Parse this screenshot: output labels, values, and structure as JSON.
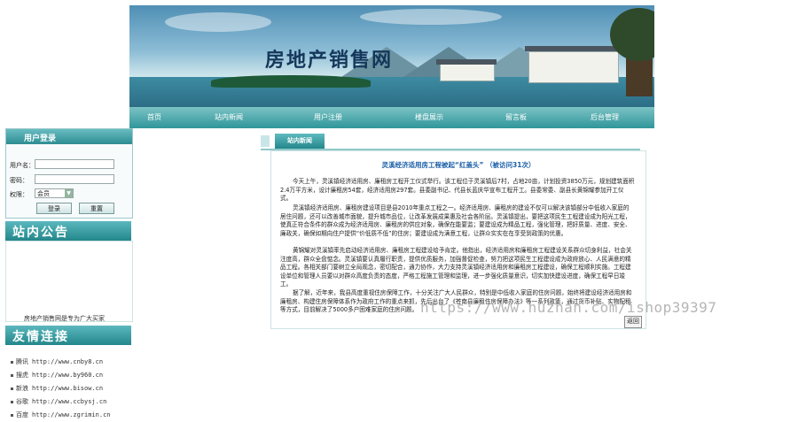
{
  "banner": {
    "title": "房地产销售网"
  },
  "nav": [
    "首页",
    "站内新闻",
    "用户注册",
    "楼盘展示",
    "留言板",
    "后台管理"
  ],
  "login": {
    "heading": "用户登录",
    "username_label": "用户名：",
    "password_label": "密码：",
    "role_label": "权限：",
    "role_value": "会员",
    "login_button": "登录",
    "reset_button": "重置"
  },
  "notice": {
    "heading": "站内公告",
    "text": "房地产销售网是专为广大买家"
  },
  "links": {
    "heading": "友情连接",
    "items": [
      {
        "name": "腾讯",
        "url": "http://www.cnby8.cn"
      },
      {
        "name": "搜虎",
        "url": "http://www.by960.cn"
      },
      {
        "name": "新浪",
        "url": "http://www.bisow.cn"
      },
      {
        "name": "谷歌",
        "url": "http://www.ccbysj.cn"
      },
      {
        "name": "百度",
        "url": "http://www.zgrimin.cn"
      }
    ]
  },
  "news": {
    "tab": "站内新闻",
    "title": "灵溪经济适用房工程被起“红盖头” （被访问31次）",
    "paragraphs": [
      "今天上午，灵溪镇经济适用房、廉租房工程开工仪式举行。该工程位于灵溪镇后7村，占地20亩，计划投资3850万元，规划建筑面积2.4万平方米，设计廉租房54套，经济适用房297套。县委副书记、代县长蓝庆华宣布工程开工。县委常委、副县长黄锦耀参加开工仪式。",
      "灵溪镇经济适用房、廉租房建设项目是县2010年重点工程之一。经济适用房、廉租房的建设不仅可以解决该镇部分中低收入家庭的居住问题，还可以改善城市面貌，提升城市品位，让改革发展成果惠及社会各阶层。灵溪镇提出，要把这项民生工程建设成为阳光工程，使真正符合条件的群众成为经济适用房、廉租房的供应对象，确保在能要监；要建设成为精品工程，强化管理，把好质量、进度、安全、廉政关，确保如期向住户提供“价低质不低”的住房；要建设成为满意工程，让群众实实在在享受到政策的优惠。",
      "黄锦耀对灵溪镇率先启动经济适用房、廉租房工程建设给予肯定。他指出，经济适用房和廉租房工程建设关系群众切身利益，社会关注度高，群众全盘惦念。灵溪镇要认真履行职责，提供优质服务，加强督促检查，努力把这项民生工程建设成为政府放心、人民满意的精品工程。各相关部门要树立全局观念，密切配合，通力协作，大力支持灵溪镇经济适用房和廉租房工程建设，确保工程顺利实施。工程建设单位和管理人员要以对群众高度负责的态度，严格工程施工管理和监理，进一步强化质量意识，切实加快建设进度，确保工程早日竣工。",
      "据了解，近年来，我县高度重视住房保障工作，十分关注广大人民群众，特别是中低收入家庭的住房问题，始终将建设经济适用房和廉租房、构建住房保障体系作为政府工作的重点来抓，先后出台了《苍南县廉租住房保障办法》等一系列政策，通过货币补贴、实物配租等方式，目前解决了5000多户困难家庭的住房问题。"
    ],
    "back_button": "返回"
  },
  "watermark": "https://www.huzhan.com/ishop39397"
}
